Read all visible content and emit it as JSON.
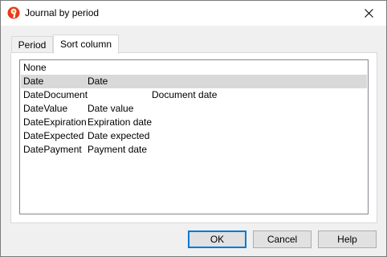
{
  "window": {
    "title": "Journal by period",
    "close_glyph": "✕",
    "app_icon": "banana-logo-icon",
    "accent_color": "#0078d7"
  },
  "tabs": [
    {
      "label": "Period",
      "selected": false
    },
    {
      "label": "Sort column",
      "selected": true
    }
  ],
  "sort_columns": {
    "rows": [
      {
        "name": "None",
        "description": "",
        "extra": ""
      },
      {
        "name": "Date",
        "description": "Date",
        "extra": "",
        "selected": true
      },
      {
        "name": "DateDocument",
        "description": "",
        "extra": "Document date"
      },
      {
        "name": "DateValue",
        "description": "Date value",
        "extra": ""
      },
      {
        "name": "DateExpiration",
        "description": "Expiration date",
        "extra": ""
      },
      {
        "name": "DateExpected",
        "description": "Date expected",
        "extra": ""
      },
      {
        "name": "DatePayment",
        "description": "Payment date",
        "extra": ""
      }
    ]
  },
  "buttons": {
    "ok": "OK",
    "cancel": "Cancel",
    "help": "Help"
  }
}
